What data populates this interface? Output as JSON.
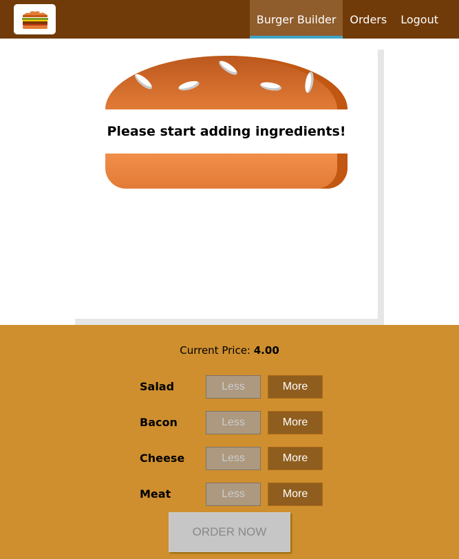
{
  "toolbar": {
    "logo_icon": "burger-logo-icon",
    "nav": [
      {
        "label": "Burger Builder",
        "active": true
      },
      {
        "label": "Orders",
        "active": false
      },
      {
        "label": "Logout",
        "active": false
      }
    ]
  },
  "burger": {
    "message": "Please start adding ingredients!"
  },
  "controls": {
    "price_label": "Current Price:",
    "price_value": "4.00",
    "ingredients": [
      {
        "label": "Salad",
        "less": "Less",
        "more": "More"
      },
      {
        "label": "Bacon",
        "less": "Less",
        "more": "More"
      },
      {
        "label": "Cheese",
        "less": "Less",
        "more": "More"
      },
      {
        "label": "Meat",
        "less": "Less",
        "more": "More"
      }
    ],
    "order_button": "ORDER NOW"
  },
  "colors": {
    "toolbar_bg": "#703B09",
    "active_indicator": "#40A4C8",
    "controls_bg": "#CF8F2E",
    "more_button": "#8F5E1E",
    "bread": "#E27B36"
  }
}
